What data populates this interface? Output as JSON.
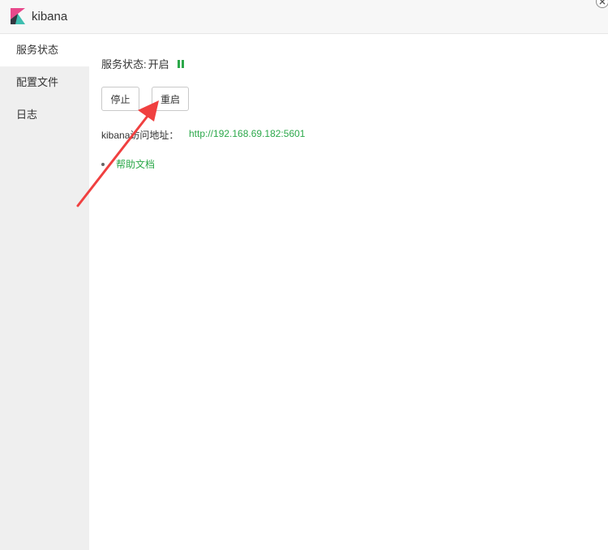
{
  "titlebar": {
    "app_title": "kibana",
    "logo_colors": {
      "pink": "#e8488b",
      "teal": "#3ebeb0",
      "dark": "#343741"
    }
  },
  "sidebar": {
    "items": [
      {
        "label": "服务状态",
        "active": true
      },
      {
        "label": "配置文件",
        "active": false
      },
      {
        "label": "日志",
        "active": false
      }
    ]
  },
  "main": {
    "status_label": "服务状态:",
    "status_value": "开启",
    "status_icon": "pause-icon",
    "stop_label": "停止",
    "restart_label": "重启",
    "url_label": "kibana访问地址：",
    "url_value": "http://192.168.69.182:5601",
    "help_label": "帮助文档"
  },
  "colors": {
    "accent_green": "#2ca84a",
    "sidebar_bg": "#efefef",
    "annotation_red": "#f04040"
  }
}
